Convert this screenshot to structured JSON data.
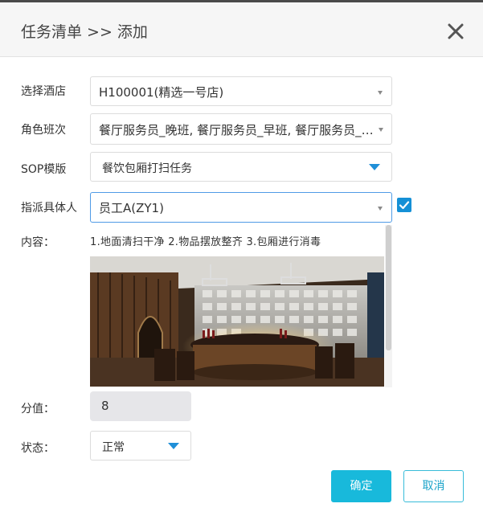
{
  "dialog": {
    "title": "任务清单 >> 添加"
  },
  "form": {
    "hotel": {
      "label": "选择酒店",
      "value": "H100001(精选一号店)"
    },
    "role_shift": {
      "label": "角色班次",
      "value": "餐厅服务员_晚班, 餐厅服务员_早班, 餐厅服务员_中班"
    },
    "sop_template": {
      "label": "SOP模版",
      "value": "餐饮包厢打扫任务"
    },
    "assignee": {
      "label": "指派具体人",
      "value": "员工A(ZY1)",
      "checked": true
    },
    "content": {
      "label": "内容：",
      "text": "1.地面清扫干净 2.物品摆放整齐 3.包厢进行消毒"
    },
    "score": {
      "label": "分值：",
      "value": "8"
    },
    "status": {
      "label": "状态：",
      "value": "正常"
    }
  },
  "buttons": {
    "confirm": "确定",
    "cancel": "取消"
  },
  "colors": {
    "accent": "#18b9db",
    "checkbox": "#1590d6",
    "dropdown_arrow": "#1f8fd8"
  }
}
